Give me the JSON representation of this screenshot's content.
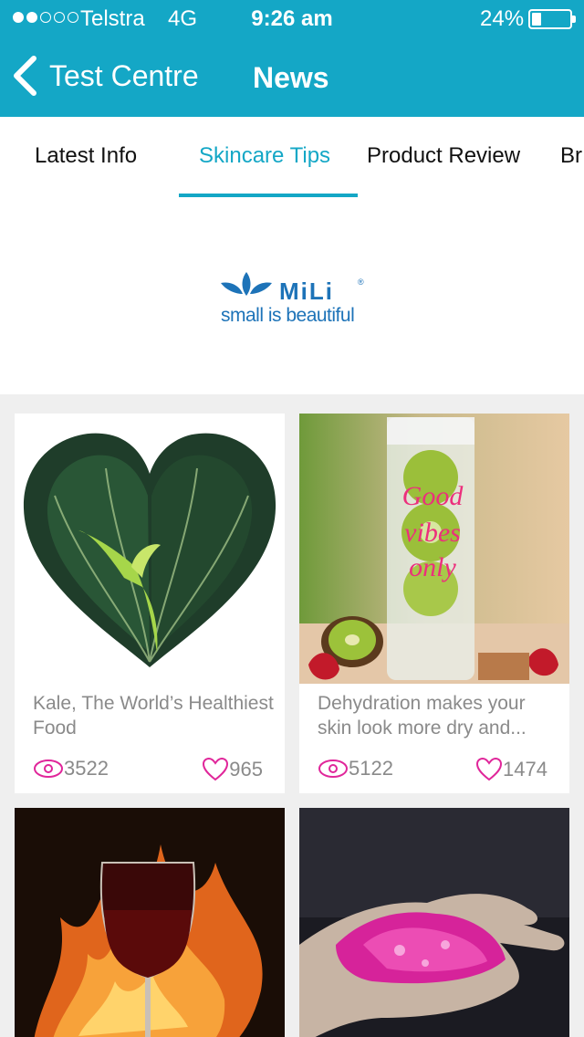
{
  "status_bar": {
    "carrier": "Telstra",
    "network": "4G",
    "time": "9:26 am",
    "battery": "24%",
    "battery_level": 0.24,
    "signal_bars": 2,
    "signal_total": 5
  },
  "nav": {
    "back_label": "Test Centre",
    "title": "News"
  },
  "tabs": [
    {
      "label": "Latest Info",
      "active": false
    },
    {
      "label": "Skincare Tips",
      "active": true
    },
    {
      "label": "Product Review",
      "active": false
    },
    {
      "label": "Br",
      "active": false
    }
  ],
  "banner": {
    "brand": "MiLi",
    "registered": "®",
    "tagline": "small is beautiful"
  },
  "cards": [
    {
      "title": "Kale, The World’s Healthiest Food",
      "views": "3522",
      "likes": "965",
      "image": "kale-heart"
    },
    {
      "title": "Dehydration makes your skin look more dry and...",
      "views": "5122",
      "likes": "1474",
      "image": "infuser-bottle"
    },
    {
      "title": "",
      "views": "",
      "likes": "",
      "image": "wine-glass-fire"
    },
    {
      "title": "",
      "views": "",
      "likes": "",
      "image": "pink-powder-hand"
    }
  ],
  "icons": {
    "back": "chevron-left-icon",
    "views": "eye-icon",
    "likes": "heart-icon"
  },
  "colors": {
    "primary": "#14a7c6",
    "accent_pink": "#e0269a",
    "brand_blue": "#1d73b8"
  }
}
